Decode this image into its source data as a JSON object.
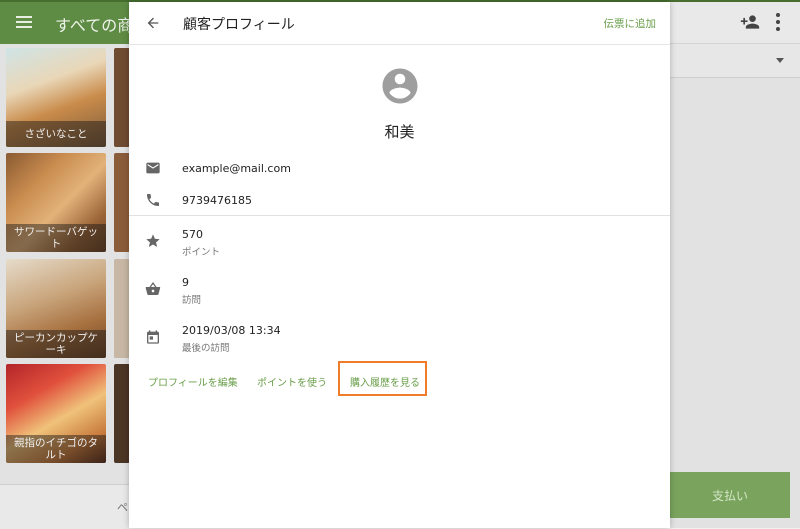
{
  "background": {
    "app_title": "すべての商品",
    "tiles": [
      {
        "label": "さざいなこと"
      },
      {
        "label": "サワードーバゲット"
      },
      {
        "label": "ピーカンカップケーキ"
      },
      {
        "label": "親指のイチゴのタルト"
      }
    ],
    "bottom_bar_text": "ペ",
    "pay_label": "支払い"
  },
  "modal": {
    "title": "顧客プロフィール",
    "add_to_slip_label": "伝票に追加",
    "customer_name": "和美",
    "email": "example@mail.com",
    "phone": "9739476185",
    "points": {
      "value": "570",
      "label": "ポイント"
    },
    "visits": {
      "value": "9",
      "label": "訪問"
    },
    "last_visit": {
      "value": "2019/03/08 13:34",
      "label": "最後の訪問"
    },
    "actions": {
      "edit_profile": "プロフィールを編集",
      "use_points": "ポイントを使う",
      "view_history": "購入履歴を見る"
    }
  },
  "colors": {
    "topbar": "#5e8c44",
    "accent_green": "#6a9e4a",
    "highlight": "#ef7c2a"
  }
}
